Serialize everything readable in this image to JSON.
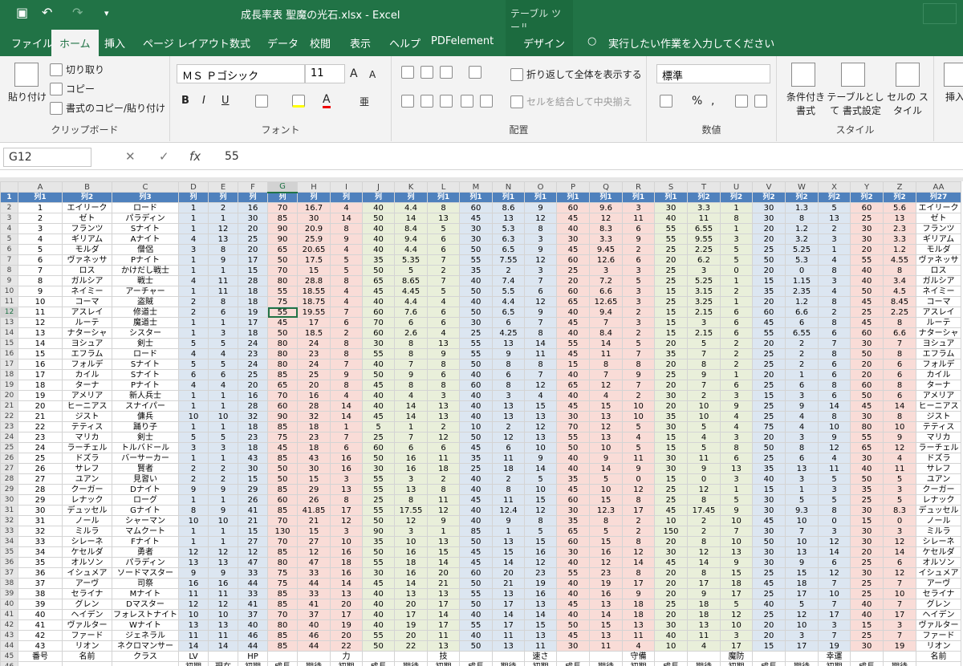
{
  "window": {
    "title": "成長率表  聖魔の光石.xlsx  -  Excel",
    "context_tab": "テーブル ツール"
  },
  "tabs": [
    "ファイル",
    "ホーム",
    "挿入",
    "ページ レイアウト",
    "数式",
    "データ",
    "校閲",
    "表示",
    "ヘルプ",
    "PDFelement",
    "デザイン"
  ],
  "search": "実行したい作業を入力してください",
  "clipboard": {
    "paste": "貼り付け",
    "cut": "切り取り",
    "copy": "コピー",
    "format_painter": "書式のコピー/貼り付け",
    "label": "クリップボード"
  },
  "font": {
    "name": "ＭＳ Ｐゴシック",
    "size": "11",
    "label": "フォント"
  },
  "alignment": {
    "wrap": "折り返して全体を表示する",
    "merge": "セルを結合して中央揃え",
    "label": "配置"
  },
  "number": {
    "format": "標準",
    "label": "数値"
  },
  "styles": {
    "conditional": "条件付き 書式",
    "table": "テーブルとして 書式設定",
    "cell": "セルの スタイル",
    "label": "スタイル"
  },
  "cells": {
    "insert": "挿入"
  },
  "formula_bar": {
    "name_box": "G12",
    "value": "55"
  },
  "columns": [
    "A",
    "B",
    "C",
    "D",
    "E",
    "F",
    "G",
    "H",
    "I",
    "J",
    "K",
    "L",
    "M",
    "N",
    "O",
    "P",
    "Q",
    "R",
    "S",
    "T",
    "U",
    "V",
    "W",
    "X",
    "Y",
    "Z",
    "AA"
  ],
  "header_row": [
    "列1",
    "列2",
    "列3",
    "列",
    "列",
    "列",
    "列",
    "列",
    "列",
    "列",
    "列",
    "列1",
    "列1",
    "列1",
    "列1",
    "列1",
    "列1",
    "列1",
    "列1",
    "列2",
    "列2",
    "列2",
    "列2",
    "列2",
    "列2",
    "列2",
    "列27"
  ],
  "rows": [
    [
      "1",
      "エイリーク",
      "ロード",
      "1",
      "2",
      "16",
      "70",
      "16.7",
      "4",
      "40",
      "4.4",
      "8",
      "60",
      "8.6",
      "9",
      "60",
      "9.6",
      "3",
      "30",
      "3.3",
      "1",
      "30",
      "1.3",
      "5",
      "60",
      "5.6",
      "エイリーク"
    ],
    [
      "2",
      "ゼト",
      "パラディン",
      "1",
      "1",
      "30",
      "85",
      "30",
      "14",
      "50",
      "14",
      "13",
      "45",
      "13",
      "12",
      "45",
      "12",
      "11",
      "40",
      "11",
      "8",
      "30",
      "8",
      "13",
      "25",
      "13",
      "ゼト"
    ],
    [
      "3",
      "フランツ",
      "Sナイト",
      "1",
      "12",
      "20",
      "90",
      "20.9",
      "8",
      "40",
      "8.4",
      "5",
      "30",
      "5.3",
      "8",
      "40",
      "8.3",
      "6",
      "55",
      "6.55",
      "1",
      "20",
      "1.2",
      "2",
      "30",
      "2.3",
      "フランツ"
    ],
    [
      "4",
      "ギリアム",
      "Aナイト",
      "4",
      "13",
      "25",
      "90",
      "25.9",
      "9",
      "40",
      "9.4",
      "6",
      "30",
      "6.3",
      "3",
      "30",
      "3.3",
      "9",
      "55",
      "9.55",
      "3",
      "20",
      "3.2",
      "3",
      "30",
      "3.3",
      "ギリアム"
    ],
    [
      "5",
      "モルダ",
      "僧侶",
      "3",
      "8",
      "20",
      "65",
      "20.65",
      "4",
      "40",
      "4.4",
      "6",
      "50",
      "6.5",
      "9",
      "45",
      "9.45",
      "2",
      "25",
      "2.25",
      "5",
      "25",
      "5.25",
      "1",
      "20",
      "1.2",
      "モルダ"
    ],
    [
      "6",
      "ヴァネッサ",
      "Pナイト",
      "1",
      "9",
      "17",
      "50",
      "17.5",
      "5",
      "35",
      "5.35",
      "7",
      "55",
      "7.55",
      "12",
      "60",
      "12.6",
      "6",
      "20",
      "6.2",
      "5",
      "50",
      "5.3",
      "4",
      "55",
      "4.55",
      "ヴァネッサ"
    ],
    [
      "7",
      "ロス",
      "かけだし戦士",
      "1",
      "1",
      "15",
      "70",
      "15",
      "5",
      "50",
      "5",
      "2",
      "35",
      "2",
      "3",
      "25",
      "3",
      "3",
      "25",
      "3",
      "0",
      "20",
      "0",
      "8",
      "40",
      "8",
      "ロス"
    ],
    [
      "8",
      "ガルシア",
      "戦士",
      "4",
      "11",
      "28",
      "80",
      "28.8",
      "8",
      "65",
      "8.65",
      "7",
      "40",
      "7.4",
      "7",
      "20",
      "7.2",
      "5",
      "25",
      "5.25",
      "1",
      "15",
      "1.15",
      "3",
      "40",
      "3.4",
      "ガルシア"
    ],
    [
      "9",
      "ネイミー",
      "アーチャー",
      "1",
      "11",
      "18",
      "55",
      "18.55",
      "4",
      "45",
      "4.45",
      "5",
      "50",
      "5.5",
      "6",
      "60",
      "6.6",
      "3",
      "15",
      "3.15",
      "2",
      "35",
      "2.35",
      "4",
      "50",
      "4.5",
      "ネイミー"
    ],
    [
      "10",
      "コーマ",
      "盗賊",
      "2",
      "8",
      "18",
      "75",
      "18.75",
      "4",
      "40",
      "4.4",
      "4",
      "40",
      "4.4",
      "12",
      "65",
      "12.65",
      "3",
      "25",
      "3.25",
      "1",
      "20",
      "1.2",
      "8",
      "45",
      "8.45",
      "コーマ"
    ],
    [
      "11",
      "アスレイ",
      "修道士",
      "2",
      "6",
      "19",
      "55",
      "19.55",
      "7",
      "60",
      "7.6",
      "6",
      "50",
      "6.5",
      "9",
      "40",
      "9.4",
      "2",
      "15",
      "2.15",
      "6",
      "60",
      "6.6",
      "2",
      "25",
      "2.25",
      "アスレイ"
    ],
    [
      "12",
      "ルーテ",
      "魔道士",
      "1",
      "1",
      "17",
      "45",
      "17",
      "6",
      "70",
      "6",
      "6",
      "30",
      "6",
      "7",
      "45",
      "7",
      "3",
      "15",
      "3",
      "6",
      "45",
      "6",
      "8",
      "45",
      "8",
      "ルーテ"
    ],
    [
      "13",
      "ナターシャ",
      "シスター",
      "1",
      "3",
      "18",
      "50",
      "18.5",
      "2",
      "60",
      "2.6",
      "4",
      "25",
      "4.25",
      "8",
      "40",
      "8.4",
      "2",
      "15",
      "2.15",
      "6",
      "55",
      "6.55",
      "6",
      "60",
      "6.6",
      "ナターシャ"
    ],
    [
      "14",
      "ヨシュア",
      "剣士",
      "5",
      "5",
      "24",
      "80",
      "24",
      "8",
      "30",
      "8",
      "13",
      "55",
      "13",
      "14",
      "55",
      "14",
      "5",
      "20",
      "5",
      "2",
      "20",
      "2",
      "7",
      "30",
      "7",
      "ヨシュア"
    ],
    [
      "15",
      "エフラム",
      "ロード",
      "4",
      "4",
      "23",
      "80",
      "23",
      "8",
      "55",
      "8",
      "9",
      "55",
      "9",
      "11",
      "45",
      "11",
      "7",
      "35",
      "7",
      "2",
      "25",
      "2",
      "8",
      "50",
      "8",
      "エフラム"
    ],
    [
      "16",
      "フォルデ",
      "Sナイト",
      "5",
      "5",
      "24",
      "80",
      "24",
      "7",
      "40",
      "7",
      "8",
      "50",
      "8",
      "8",
      "15",
      "8",
      "8",
      "20",
      "8",
      "2",
      "25",
      "2",
      "6",
      "20",
      "6",
      "フォルデ"
    ],
    [
      "17",
      "カイル",
      "Sナイト",
      "6",
      "6",
      "25",
      "85",
      "25",
      "9",
      "50",
      "9",
      "6",
      "40",
      "6",
      "7",
      "40",
      "7",
      "9",
      "25",
      "9",
      "1",
      "20",
      "1",
      "6",
      "20",
      "6",
      "カイル"
    ],
    [
      "18",
      "ターナ",
      "Pナイト",
      "4",
      "4",
      "20",
      "65",
      "20",
      "8",
      "45",
      "8",
      "8",
      "60",
      "8",
      "12",
      "65",
      "12",
      "7",
      "20",
      "7",
      "6",
      "25",
      "6",
      "8",
      "60",
      "8",
      "ターナ"
    ],
    [
      "19",
      "アメリア",
      "新人兵士",
      "1",
      "1",
      "16",
      "70",
      "16",
      "4",
      "40",
      "4",
      "3",
      "40",
      "3",
      "4",
      "40",
      "4",
      "2",
      "30",
      "2",
      "3",
      "15",
      "3",
      "6",
      "50",
      "6",
      "アメリア"
    ],
    [
      "20",
      "ヒーニアス",
      "スナイパー",
      "1",
      "1",
      "28",
      "60",
      "28",
      "14",
      "40",
      "14",
      "13",
      "40",
      "13",
      "15",
      "45",
      "15",
      "10",
      "20",
      "10",
      "9",
      "25",
      "9",
      "14",
      "45",
      "14",
      "ヒーニアス"
    ],
    [
      "21",
      "ジスト",
      "傭兵",
      "10",
      "10",
      "32",
      "90",
      "32",
      "14",
      "45",
      "14",
      "13",
      "40",
      "13",
      "13",
      "30",
      "13",
      "10",
      "35",
      "10",
      "4",
      "25",
      "4",
      "8",
      "30",
      "8",
      "ジスト"
    ],
    [
      "22",
      "テティス",
      "踊り子",
      "1",
      "1",
      "18",
      "85",
      "18",
      "1",
      "5",
      "1",
      "2",
      "10",
      "2",
      "12",
      "70",
      "12",
      "5",
      "30",
      "5",
      "4",
      "75",
      "4",
      "10",
      "80",
      "10",
      "テティス"
    ],
    [
      "23",
      "マリカ",
      "剣士",
      "5",
      "5",
      "23",
      "75",
      "23",
      "7",
      "25",
      "7",
      "12",
      "50",
      "12",
      "13",
      "55",
      "13",
      "4",
      "15",
      "4",
      "3",
      "20",
      "3",
      "9",
      "55",
      "9",
      "マリカ"
    ],
    [
      "24",
      "ラーチェル",
      "トルバドール",
      "3",
      "3",
      "18",
      "45",
      "18",
      "6",
      "60",
      "6",
      "6",
      "45",
      "6",
      "10",
      "50",
      "10",
      "5",
      "15",
      "5",
      "8",
      "50",
      "8",
      "12",
      "65",
      "12",
      "ラーチェル"
    ],
    [
      "25",
      "ドズラ",
      "バーサーカー",
      "1",
      "1",
      "43",
      "85",
      "43",
      "16",
      "50",
      "16",
      "11",
      "35",
      "11",
      "9",
      "40",
      "9",
      "11",
      "30",
      "11",
      "6",
      "25",
      "6",
      "4",
      "30",
      "4",
      "ドズラ"
    ],
    [
      "26",
      "サレフ",
      "賢者",
      "2",
      "2",
      "30",
      "50",
      "30",
      "16",
      "30",
      "16",
      "18",
      "25",
      "18",
      "14",
      "40",
      "14",
      "9",
      "30",
      "9",
      "13",
      "35",
      "13",
      "11",
      "40",
      "11",
      "サレフ"
    ],
    [
      "27",
      "ユアン",
      "見習い",
      "2",
      "2",
      "15",
      "50",
      "15",
      "3",
      "55",
      "3",
      "2",
      "40",
      "2",
      "5",
      "35",
      "5",
      "0",
      "15",
      "0",
      "3",
      "40",
      "3",
      "5",
      "50",
      "5",
      "ユアン"
    ],
    [
      "28",
      "クーガー",
      "Dナイト",
      "9",
      "9",
      "29",
      "85",
      "29",
      "13",
      "55",
      "13",
      "8",
      "40",
      "8",
      "10",
      "45",
      "10",
      "12",
      "25",
      "12",
      "1",
      "15",
      "1",
      "3",
      "35",
      "3",
      "クーガー"
    ],
    [
      "29",
      "レナック",
      "ローグ",
      "1",
      "1",
      "26",
      "60",
      "26",
      "8",
      "25",
      "8",
      "11",
      "45",
      "11",
      "15",
      "60",
      "15",
      "8",
      "25",
      "8",
      "5",
      "30",
      "5",
      "5",
      "25",
      "5",
      "レナック"
    ],
    [
      "30",
      "デュッセル",
      "Gナイト",
      "8",
      "9",
      "41",
      "85",
      "41.85",
      "17",
      "55",
      "17.55",
      "12",
      "40",
      "12.4",
      "12",
      "30",
      "12.3",
      "17",
      "45",
      "17.45",
      "9",
      "30",
      "9.3",
      "8",
      "30",
      "8.3",
      "デュッセル"
    ],
    [
      "31",
      "ノール",
      "シャーマン",
      "10",
      "10",
      "21",
      "70",
      "21",
      "12",
      "50",
      "12",
      "9",
      "40",
      "9",
      "8",
      "35",
      "8",
      "2",
      "10",
      "2",
      "10",
      "45",
      "10",
      "0",
      "15",
      "0",
      "ノール"
    ],
    [
      "32",
      "ミルラ",
      "マムクート",
      "1",
      "1",
      "15",
      "130",
      "15",
      "3",
      "90",
      "3",
      "1",
      "85",
      "1",
      "5",
      "65",
      "5",
      "2",
      "150",
      "2",
      "7",
      "30",
      "7",
      "3",
      "30",
      "3",
      "ミルラ"
    ],
    [
      "33",
      "シレーネ",
      "Fナイト",
      "1",
      "1",
      "27",
      "70",
      "27",
      "10",
      "35",
      "10",
      "13",
      "50",
      "13",
      "15",
      "60",
      "15",
      "8",
      "20",
      "8",
      "10",
      "50",
      "10",
      "12",
      "30",
      "12",
      "シレーネ"
    ],
    [
      "34",
      "ケセルダ",
      "勇者",
      "12",
      "12",
      "12",
      "85",
      "12",
      "16",
      "50",
      "16",
      "15",
      "45",
      "15",
      "16",
      "30",
      "16",
      "12",
      "30",
      "12",
      "13",
      "30",
      "13",
      "14",
      "20",
      "14",
      "ケセルダ"
    ],
    [
      "35",
      "オルソン",
      "パラディン",
      "13",
      "13",
      "47",
      "80",
      "47",
      "18",
      "55",
      "18",
      "14",
      "45",
      "14",
      "12",
      "40",
      "12",
      "14",
      "45",
      "14",
      "9",
      "30",
      "9",
      "6",
      "25",
      "6",
      "オルソン"
    ],
    [
      "36",
      "イシュメア",
      "ソードマスター",
      "9",
      "9",
      "33",
      "75",
      "33",
      "16",
      "30",
      "16",
      "20",
      "60",
      "20",
      "23",
      "55",
      "23",
      "8",
      "20",
      "8",
      "15",
      "25",
      "15",
      "12",
      "30",
      "12",
      "イシュメア"
    ],
    [
      "37",
      "アーヴ",
      "司祭",
      "16",
      "16",
      "44",
      "75",
      "44",
      "14",
      "45",
      "14",
      "21",
      "50",
      "21",
      "19",
      "40",
      "19",
      "17",
      "20",
      "17",
      "18",
      "45",
      "18",
      "7",
      "25",
      "7",
      "アーヴ"
    ],
    [
      "38",
      "セライナ",
      "Mナイト",
      "11",
      "11",
      "33",
      "85",
      "33",
      "13",
      "40",
      "13",
      "13",
      "55",
      "13",
      "16",
      "40",
      "16",
      "9",
      "20",
      "9",
      "17",
      "25",
      "17",
      "10",
      "25",
      "10",
      "セライナ"
    ],
    [
      "39",
      "グレン",
      "Dマスター",
      "12",
      "12",
      "41",
      "85",
      "41",
      "20",
      "40",
      "20",
      "17",
      "50",
      "17",
      "13",
      "45",
      "13",
      "18",
      "25",
      "18",
      "5",
      "40",
      "5",
      "7",
      "40",
      "7",
      "グレン"
    ],
    [
      "40",
      "ヘイデン",
      "フォレストナイト",
      "10",
      "10",
      "37",
      "70",
      "37",
      "17",
      "40",
      "17",
      "14",
      "40",
      "14",
      "14",
      "40",
      "14",
      "18",
      "20",
      "18",
      "12",
      "25",
      "12",
      "17",
      "40",
      "17",
      "ヘイデン"
    ],
    [
      "41",
      "ヴァルター",
      "Wナイト",
      "13",
      "13",
      "40",
      "80",
      "40",
      "19",
      "40",
      "19",
      "17",
      "55",
      "17",
      "15",
      "50",
      "15",
      "13",
      "30",
      "13",
      "10",
      "20",
      "10",
      "3",
      "15",
      "3",
      "ヴァルター"
    ],
    [
      "42",
      "ファード",
      "ジェネラル",
      "11",
      "11",
      "46",
      "85",
      "46",
      "20",
      "55",
      "20",
      "11",
      "40",
      "11",
      "13",
      "45",
      "13",
      "11",
      "40",
      "11",
      "3",
      "20",
      "3",
      "7",
      "25",
      "7",
      "ファード"
    ],
    [
      "43",
      "リオン",
      "ネクロマンサー",
      "14",
      "14",
      "44",
      "85",
      "44",
      "22",
      "50",
      "22",
      "13",
      "50",
      "13",
      "11",
      "30",
      "11",
      "4",
      "10",
      "4",
      "17",
      "15",
      "17",
      "19",
      "30",
      "19",
      "リオン"
    ]
  ],
  "footer1": [
    "番号",
    "名前",
    "クラス",
    "LV",
    "",
    "HP",
    "",
    "",
    "力",
    "",
    "",
    "技",
    "",
    "",
    "速さ",
    "",
    "",
    "守備",
    "",
    "",
    "魔防",
    "",
    "",
    "幸運",
    "",
    "",
    "名前"
  ],
  "footer2": [
    "",
    "",
    "",
    "初期",
    "現在",
    "初期",
    "成長",
    "期待",
    "初期",
    "成長",
    "期待",
    "初期",
    "成長",
    "期待",
    "初期",
    "成長",
    "期待",
    "初期",
    "成長",
    "期待",
    "初期",
    "成長",
    "期待",
    "初期",
    "成長",
    "期待",
    ""
  ]
}
